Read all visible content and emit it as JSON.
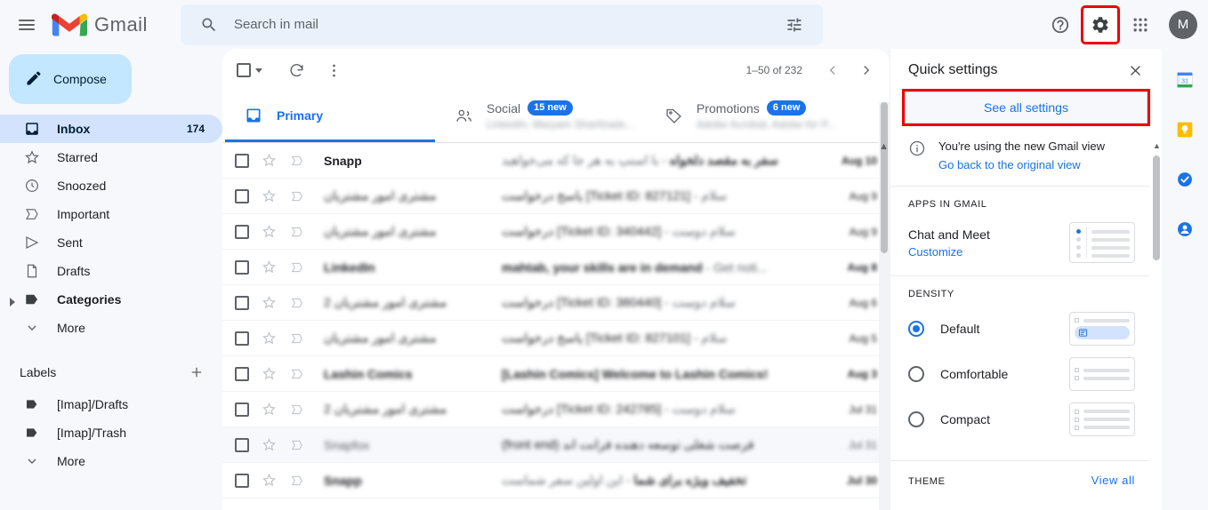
{
  "app": {
    "brand_name": "Gmail",
    "menu_icon": "hamburger-icon",
    "logo_icon": "gmail-logo-icon"
  },
  "search": {
    "placeholder": "Search in mail",
    "value": "",
    "search_icon": "search-icon",
    "filter_icon": "tune-options-icon"
  },
  "topbar": {
    "help_icon": "help-question-icon",
    "settings_icon": "gear-icon",
    "apps_icon": "google-apps-grid-icon",
    "avatar_letter": "M",
    "settings_highlight_color": "#ee0000"
  },
  "sidebar": {
    "compose_label": "Compose",
    "compose_icon": "pencil-icon",
    "items": [
      {
        "label": "Inbox",
        "icon": "inbox-icon",
        "count": "174",
        "active": true
      },
      {
        "label": "Starred",
        "icon": "star-outline-icon",
        "count": "",
        "active": false
      },
      {
        "label": "Snoozed",
        "icon": "clock-icon",
        "count": "",
        "active": false
      },
      {
        "label": "Important",
        "icon": "important-chevron-icon",
        "count": "",
        "active": false
      },
      {
        "label": "Sent",
        "icon": "send-arrow-icon",
        "count": "",
        "active": false
      },
      {
        "label": "Drafts",
        "icon": "document-icon",
        "count": "",
        "active": false
      },
      {
        "label": "Categories",
        "icon": "label-tag-icon",
        "count": "",
        "active": false,
        "expandable": true
      },
      {
        "label": "More",
        "icon": "chevron-down-icon",
        "count": "",
        "active": false
      }
    ],
    "labels_title": "Labels",
    "add_label_icon": "plus-icon",
    "labels": [
      {
        "label": "[Imap]/Drafts",
        "icon": "label-tag-icon"
      },
      {
        "label": "[Imap]/Trash",
        "icon": "label-tag-icon"
      },
      {
        "label": "More",
        "icon": "chevron-down-icon"
      }
    ]
  },
  "list_toolbar": {
    "select_all_icon": "checkbox-icon",
    "select_all_caret_icon": "chevron-down-icon",
    "refresh_icon": "refresh-icon",
    "more_icon": "more-vertical-icon",
    "pager_text": "1–50 of 232",
    "prev_icon": "chevron-left-icon",
    "next_icon": "chevron-right-icon"
  },
  "tabs": [
    {
      "name": "Primary",
      "icon": "inbox-tab-icon",
      "badge": "",
      "subtitle": "",
      "active": true
    },
    {
      "name": "Social",
      "icon": "people-icon",
      "badge": "15 new",
      "subtitle": "LinkedIn, Maryam Sharifzade...",
      "active": false
    },
    {
      "name": "Promotions",
      "icon": "tag-icon",
      "badge": "6 new",
      "subtitle": "Adobe Acrobat, Adobe for P...",
      "active": false
    }
  ],
  "emails": [
    {
      "sender": "Snapp",
      "subject": "سفر به مقصد دلخواه",
      "snippet": " - با اسنپ به هر جا که می‌خواهید",
      "date": "Aug 10",
      "unread": true,
      "sender_blur": false,
      "subject_blur": true
    },
    {
      "sender": "مشتری امور مشتریان",
      "subject": "پاسخ درخواست [Ticket ID: 827121]",
      "snippet": " - سلام",
      "date": "Aug 9",
      "unread": false,
      "sender_blur": true,
      "subject_blur": true
    },
    {
      "sender": "مشتری امور مشتریان",
      "subject": "درخواست [Ticket ID: 340442]",
      "snippet": " - سلام دوست",
      "date": "Aug 9",
      "unread": false,
      "sender_blur": true,
      "subject_blur": true
    },
    {
      "sender": "LinkedIn",
      "subject": "mahtab, your skills are in demand",
      "snippet": " - Get noti...",
      "date": "Aug 8",
      "unread": true,
      "sender_blur": true,
      "subject_blur": true
    },
    {
      "sender": "مشتری امور مشتریان 2",
      "subject": "درخواست [Ticket ID: 380440]",
      "snippet": " - سلام دوست",
      "date": "Aug 6",
      "unread": false,
      "sender_blur": true,
      "subject_blur": true
    },
    {
      "sender": "مشتری امور مشتریان",
      "subject": "پاسخ درخواست [Ticket ID: 827101]",
      "snippet": " - سلام",
      "date": "Aug 5",
      "unread": false,
      "sender_blur": true,
      "subject_blur": true
    },
    {
      "sender": "Lashin Comics",
      "subject": "[Lashin Comics] Welcome to Lashin Comics!",
      "snippet": "",
      "date": "Aug 3",
      "unread": true,
      "sender_blur": true,
      "subject_blur": true
    },
    {
      "sender": "مشتری امور مشتریان 2",
      "subject": "درخواست [Ticket ID: 242785]",
      "snippet": " - سلام دوست",
      "date": "Jul 31",
      "unread": false,
      "sender_blur": true,
      "subject_blur": true
    },
    {
      "sender": "Snapfox",
      "subject": "(front end) فرصت شغلی توسعه دهنده فرانت اند",
      "snippet": "",
      "date": "Jul 31",
      "unread": false,
      "sender_blur": true,
      "subject_blur": true,
      "read_row": true
    },
    {
      "sender": "Snapp",
      "subject": "تخفیف ویژه برای شما",
      "snippet": " - این اولین سفر شماست",
      "date": "Jul 30",
      "unread": true,
      "sender_blur": true,
      "subject_blur": true
    }
  ],
  "quick_settings": {
    "title": "Quick settings",
    "close_icon": "close-x-icon",
    "see_all_label": "See all settings",
    "see_all_highlight_color": "#ee0000",
    "notice": {
      "icon": "info-circle-icon",
      "line1": "You're using the new Gmail view",
      "link": "Go back to the original view"
    },
    "apps_section": {
      "title": "APPS IN GMAIL",
      "row_label": "Chat and Meet",
      "link": "Customize"
    },
    "density_section": {
      "title": "DENSITY",
      "options": [
        {
          "label": "Default",
          "selected": true
        },
        {
          "label": "Comfortable",
          "selected": false
        },
        {
          "label": "Compact",
          "selected": false
        }
      ]
    },
    "theme_section": {
      "title": "THEME",
      "link": "View all"
    }
  },
  "right_rail": [
    {
      "icon": "google-calendar-icon",
      "name": "calendar"
    },
    {
      "icon": "google-keep-icon",
      "name": "keep"
    },
    {
      "icon": "google-tasks-icon",
      "name": "tasks"
    },
    {
      "icon": "google-contacts-icon",
      "name": "contacts"
    }
  ]
}
